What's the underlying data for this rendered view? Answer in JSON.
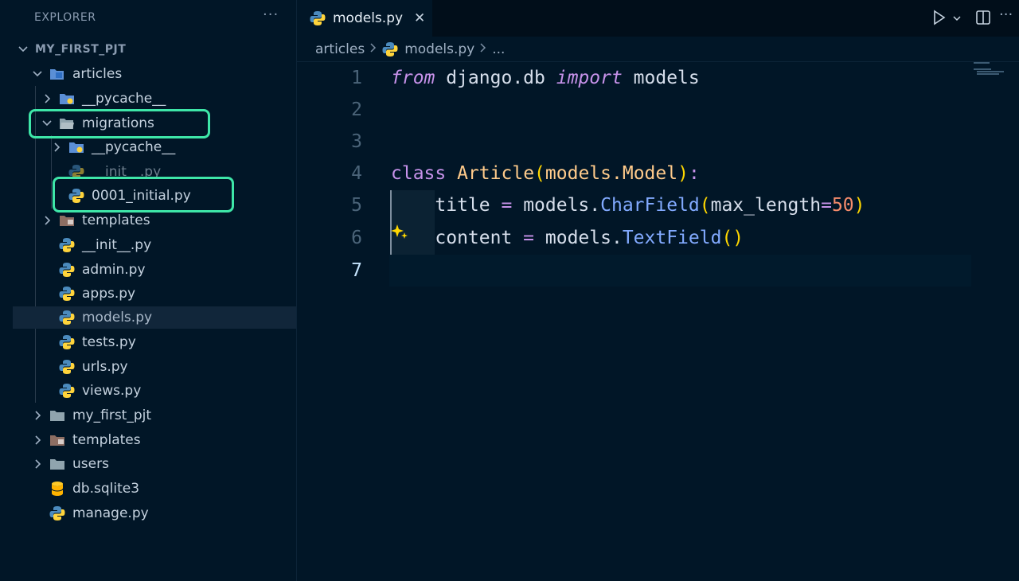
{
  "sidebar": {
    "title": "EXPLORER",
    "more": "···",
    "root": "MY_FIRST_PJT",
    "tree": {
      "articles": "articles",
      "articles_pycache": "__pycache__",
      "migrations": "migrations",
      "migrations_pycache": "__pycache__",
      "migrations_init": "__init__.py",
      "migration_0001": "0001_initial.py",
      "articles_templates": "templates",
      "articles_init": "__init__.py",
      "admin": "admin.py",
      "apps": "apps.py",
      "models": "models.py",
      "tests": "tests.py",
      "urls": "urls.py",
      "views": "views.py",
      "my_first_pjt": "my_first_pjt",
      "templates": "templates",
      "users": "users",
      "db": "db.sqlite3",
      "manage": "manage.py"
    }
  },
  "editor": {
    "tab_label": "models.py",
    "tab_close": "✕",
    "more_actions": "···",
    "breadcrumb": {
      "folder": "articles",
      "file": "models.py",
      "tail": "..."
    },
    "line_numbers": [
      "1",
      "2",
      "3",
      "4",
      "5",
      "6",
      "7"
    ],
    "code": {
      "l1_from": "from",
      "l1_mod": " django.db ",
      "l1_import": "import",
      "l1_name": " models",
      "l4_class": "class",
      "l4_sp": " ",
      "l4_name": "Article",
      "l4_open": "(",
      "l4_base": "models.",
      "l4_model": "Model",
      "l4_close": ")",
      "l4_colon": ":",
      "l5_indent": "    ",
      "l5_var": "title ",
      "l5_eq": "=",
      "l5_mod": " models.",
      "l5_fn": "CharField",
      "l5_open": "(",
      "l5_arg": "max_length",
      "l5_argeq": "=",
      "l5_num": "50",
      "l5_close": ")",
      "l6_indent": "    ",
      "l6_var": "content ",
      "l6_eq": "=",
      "l6_mod": " models.",
      "l6_fn": "TextField",
      "l6_parens": "()"
    }
  },
  "colors": {
    "background": "#011627",
    "highlight_box": "#3ee6a8",
    "keyword": "#c792ea",
    "class_name": "#ffcb8b",
    "function": "#82aaff",
    "number": "#f78c6c",
    "bracket": "#ffd700"
  }
}
